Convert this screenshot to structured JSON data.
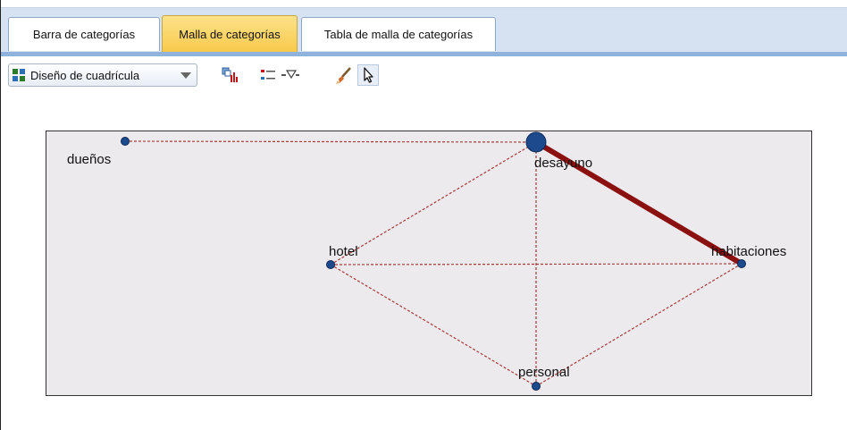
{
  "tabs": [
    {
      "label": "Barra de categorías",
      "active": false
    },
    {
      "label": "Malla de categorías",
      "active": true
    },
    {
      "label": "Tabla de malla de categorías",
      "active": false
    }
  ],
  "toolbar": {
    "layout_select": "Diseño de cuadrícula",
    "icons": [
      "display-chart-icon",
      "legend-icon",
      "filter-dropdown-icon",
      "paintbrush-icon",
      "pointer-icon"
    ]
  },
  "colors": {
    "tab_active": "#f8c94a",
    "tab_bar": "#d6e2f1",
    "panel_bg": "#edeaed",
    "node": "#1c4a8c",
    "strong_link": "#8b1010",
    "weak_link": "#a83a3a"
  },
  "web": {
    "nodes": [
      {
        "label": "dueños",
        "size": "small"
      },
      {
        "label": "desayuno",
        "size": "large"
      },
      {
        "label": "hotel",
        "size": "small"
      },
      {
        "label": "habitaciones",
        "size": "small"
      },
      {
        "label": "personal",
        "size": "small"
      }
    ],
    "links": [
      {
        "from": "dueños",
        "to": "desayuno",
        "strength": "weak"
      },
      {
        "from": "desayuno",
        "to": "habitaciones",
        "strength": "strong"
      },
      {
        "from": "desayuno",
        "to": "hotel",
        "strength": "weak"
      },
      {
        "from": "desayuno",
        "to": "personal",
        "strength": "weak"
      },
      {
        "from": "hotel",
        "to": "habitaciones",
        "strength": "weak"
      },
      {
        "from": "hotel",
        "to": "personal",
        "strength": "weak"
      },
      {
        "from": "habitaciones",
        "to": "personal",
        "strength": "weak"
      }
    ]
  }
}
